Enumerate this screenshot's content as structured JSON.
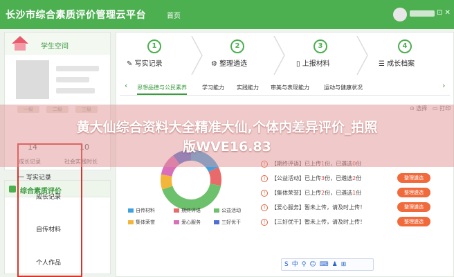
{
  "header": {
    "title": "长沙市综合素质评价管理云平台",
    "home": "首页",
    "icons": "⊡ ✕"
  },
  "sidebar": {
    "space_title": "学生空间",
    "chips": [
      "一级",
      "二级",
      "三级"
    ],
    "stats": [
      {
        "value": "14",
        "label": "成长记录"
      },
      {
        "value": "10",
        "label": "社会实践时长"
      }
    ],
    "section_title": "综合素质评价",
    "menu_main": "一 写实记录",
    "menu_items": [
      "成长记录",
      "自传材料",
      "个人作品"
    ]
  },
  "steps": [
    {
      "num": "1",
      "icon": "✎",
      "label": "写实记录"
    },
    {
      "num": "2",
      "icon": "⚙",
      "label": "整理遴选"
    },
    {
      "num": "3",
      "icon": "▯",
      "label": "上报材料"
    },
    {
      "num": "4",
      "icon": "☰",
      "label": "成长档案"
    }
  ],
  "tabs": [
    "思想品德与公民素养",
    "学习能力",
    "实践能力",
    "审美与表现能力",
    "运动与健康状况"
  ],
  "nav": {
    "prev": "‹",
    "next": "›"
  },
  "toolbar": {
    "left": "⊙ 选择",
    "right": "▭ 打印"
  },
  "banner": {
    "line1": "黄大仙综合资料大全精准大仙,个体内差异评价_拍照",
    "line2": "版WVE16.83"
  },
  "chart_data": {
    "type": "pie",
    "series": [
      {
        "name": "自传材料",
        "value": 18,
        "color": "#3fa2e0"
      },
      {
        "name": "期终评语",
        "value": 10,
        "color": "#e86a6a"
      },
      {
        "name": "公益活动",
        "value": 42,
        "color": "#6dc16d"
      },
      {
        "name": "集体荣誉",
        "value": 8,
        "color": "#f3b63a"
      },
      {
        "name": "爱心服务",
        "value": 12,
        "color": "#d86fb8"
      },
      {
        "name": "三好优干",
        "value": 10,
        "color": "#4f6fd2"
      }
    ]
  },
  "records": [
    {
      "prefix": "【期终评语】已上传",
      "count": "1",
      "mid": "份，已遴选",
      "sel": "0",
      "suffix": "份",
      "button": ""
    },
    {
      "prefix": "【公益活动】已上传",
      "count": "3",
      "mid": "份，已遴选",
      "sel": "2",
      "suffix": "份",
      "button": "整理遴选"
    },
    {
      "prefix": "【集体荣誉】已上传",
      "count": "2",
      "mid": "份，已遴选",
      "sel": "1",
      "suffix": "份",
      "button": "整理遴选"
    },
    {
      "prefix": "【爱心服务】",
      "count": "",
      "mid": "暂未上传，请及时上传！",
      "sel": "",
      "suffix": "",
      "button": "整理遴选"
    },
    {
      "prefix": "【三好优干】",
      "count": "",
      "mid": "暂未上传，请及时上传！",
      "sel": "",
      "suffix": "",
      "button": "整理遴选"
    }
  ],
  "ime": {
    "text": "S中⚲☺⌨♟⊞"
  }
}
